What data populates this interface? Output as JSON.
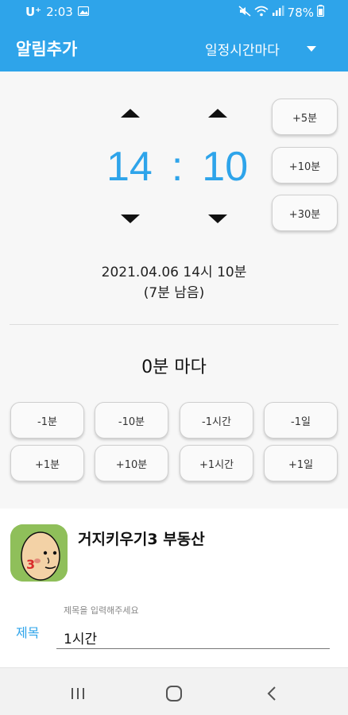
{
  "status_bar": {
    "carrier": "U⁺",
    "time": "2:03",
    "battery": "78%"
  },
  "app_bar": {
    "title": "알림추가",
    "repeat_mode": "일정시간마다"
  },
  "time_picker": {
    "hour": "14",
    "separator": ":",
    "minute": "10"
  },
  "quick_add": {
    "plus5": "+5분",
    "plus10": "+10분",
    "plus30": "+30분"
  },
  "schedule": {
    "datetime": "2021.04.06 14시 10분",
    "remaining": "(7분 남음)"
  },
  "interval": {
    "text": "0분 마다",
    "minus_buttons": [
      "-1분",
      "-10분",
      "-1시간",
      "-1일"
    ],
    "plus_buttons": [
      "+1분",
      "+10분",
      "+1시간",
      "+1일"
    ]
  },
  "item": {
    "title": "거지키우기3 부동산"
  },
  "title_field": {
    "label": "제목",
    "placeholder": "제목을 입력해주세요",
    "value": "1시간"
  },
  "colors": {
    "accent": "#2ea4ea",
    "background": "#f7f7f7"
  }
}
